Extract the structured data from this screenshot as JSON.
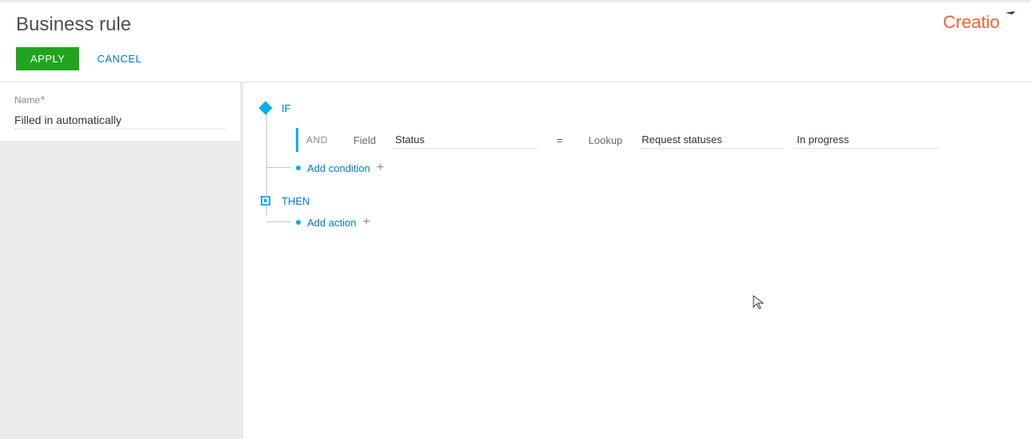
{
  "header": {
    "title": "Business rule",
    "apply_label": "APPLY",
    "cancel_label": "CANCEL",
    "logo_text": "Creatio"
  },
  "sidebar": {
    "name_label": "Name",
    "name_value": "Filled in automatically"
  },
  "rule": {
    "if_label": "IF",
    "and_label": "AND",
    "field_label": "Field",
    "status_value": "Status",
    "equals": "=",
    "lookup_label": "Lookup",
    "lookup_source": "Request statuses",
    "lookup_value": "In progress",
    "add_condition": "Add condition",
    "then_label": "THEN",
    "add_action": "Add action"
  }
}
